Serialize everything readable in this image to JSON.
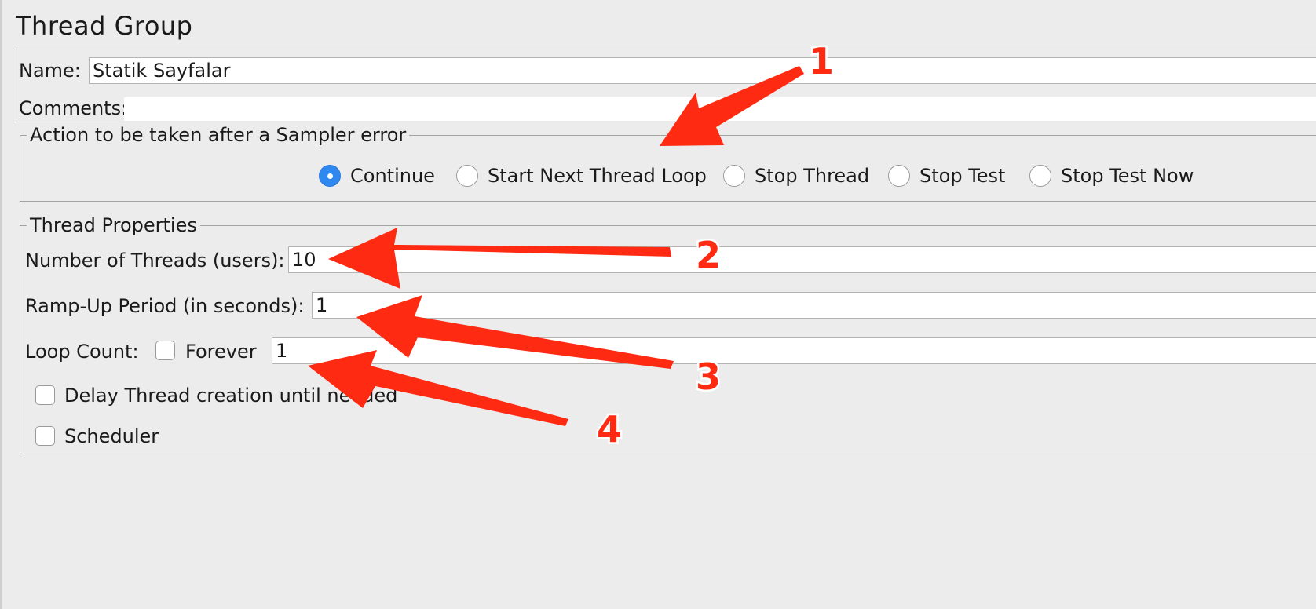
{
  "panel": {
    "title": "Thread Group"
  },
  "name_field": {
    "label": "Name:",
    "value": "Statik Sayfalar"
  },
  "comments_field": {
    "label": "Comments:",
    "value": ""
  },
  "sampler_error": {
    "legend": "Action to be taken after a Sampler error",
    "options": [
      {
        "label": "Continue",
        "selected": true
      },
      {
        "label": "Start Next Thread Loop",
        "selected": false
      },
      {
        "label": "Stop Thread",
        "selected": false
      },
      {
        "label": "Stop Test",
        "selected": false
      },
      {
        "label": "Stop Test Now",
        "selected": false
      }
    ]
  },
  "thread_properties": {
    "legend": "Thread Properties",
    "num_threads": {
      "label": "Number of Threads (users):",
      "value": "10"
    },
    "ramp_up": {
      "label": "Ramp-Up Period (in seconds):",
      "value": "1"
    },
    "loop_count": {
      "label": "Loop Count:",
      "forever_label": "Forever",
      "forever_checked": false,
      "value": "1"
    },
    "delay_creation": {
      "label": "Delay Thread creation until needed",
      "checked": false
    },
    "scheduler": {
      "label": "Scheduler",
      "checked": false
    }
  },
  "annotations": {
    "color": "#ff2a12",
    "labels": [
      "1",
      "2",
      "3",
      "4"
    ]
  }
}
